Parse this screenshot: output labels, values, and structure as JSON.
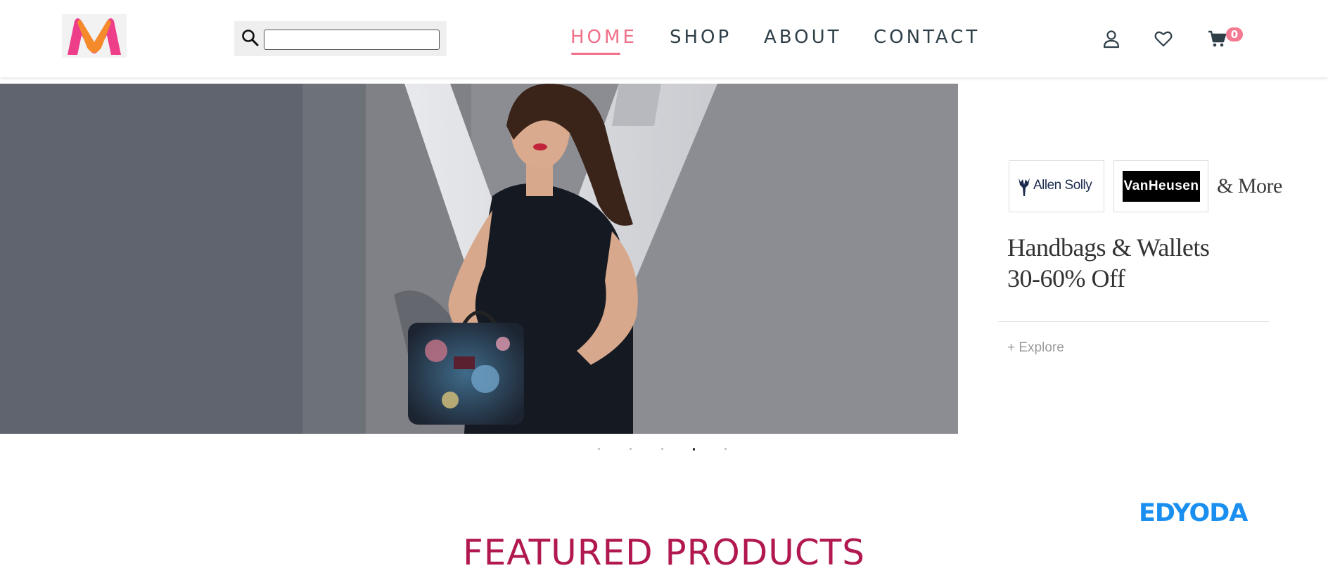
{
  "header": {
    "search": {
      "value": "",
      "placeholder": ""
    },
    "nav": [
      {
        "label": "HOME",
        "active": true
      },
      {
        "label": "SHOP",
        "active": false
      },
      {
        "label": "ABOUT",
        "active": false
      },
      {
        "label": "CONTACT",
        "active": false
      }
    ],
    "icons": [
      "user-icon",
      "heart-icon",
      "cart-icon"
    ],
    "cart_count": "0",
    "logo_icon": "myntra-m-logo",
    "accent_color": "#f0708a"
  },
  "banner": {
    "brands": {
      "allen_solly": "Allen Solly",
      "van_heusen": "VanHeusen",
      "more": "& More"
    },
    "promo": {
      "line1": "Handbags & Wallets",
      "line2": "30-60% Off"
    },
    "explore_label": "+ Explore",
    "slides_count": 5,
    "active_slide": 4
  },
  "edyoda_label": "EDYODA",
  "featured_title": "FEATURED PRODUCTS"
}
